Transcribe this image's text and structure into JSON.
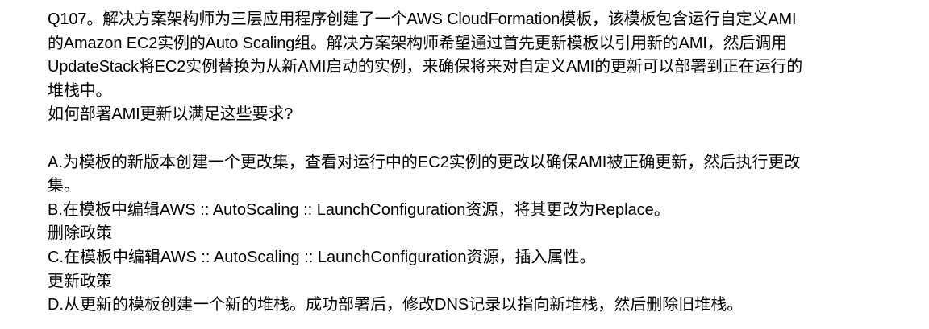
{
  "question": {
    "lines": [
      "Q107。解决方案架构师为三层应用程序创建了一个AWS CloudFormation模板，该模板包含运行自定义AMI",
      "的Amazon EC2实例的Auto Scaling组。解决方案架构师希望通过首先更新模板以引用新的AMI，然后调用",
      "UpdateStack将EC2实例替换为从新AMI启动的实例，来确保将来对自定义AMI的更新可以部署到正在运行的",
      "堆栈中。",
      "如何部署AMI更新以满足这些要求?"
    ]
  },
  "options": {
    "a": [
      "A.为模板的新版本创建一个更改集，查看对运行中的EC2实例的更改以确保AMI被正确更新，然后执行更改",
      "集。"
    ],
    "b": [
      "B.在模板中编辑AWS :: AutoScaling :: LaunchConfiguration资源，将其更改为Replace。",
      "删除政策"
    ],
    "c": [
      "C.在模板中编辑AWS :: AutoScaling :: LaunchConfiguration资源，插入属性。",
      "更新政策"
    ],
    "d": [
      "D.从更新的模板创建一个新的堆栈。成功部署后，修改DNS记录以指向新堆栈，然后删除旧堆栈。"
    ]
  }
}
